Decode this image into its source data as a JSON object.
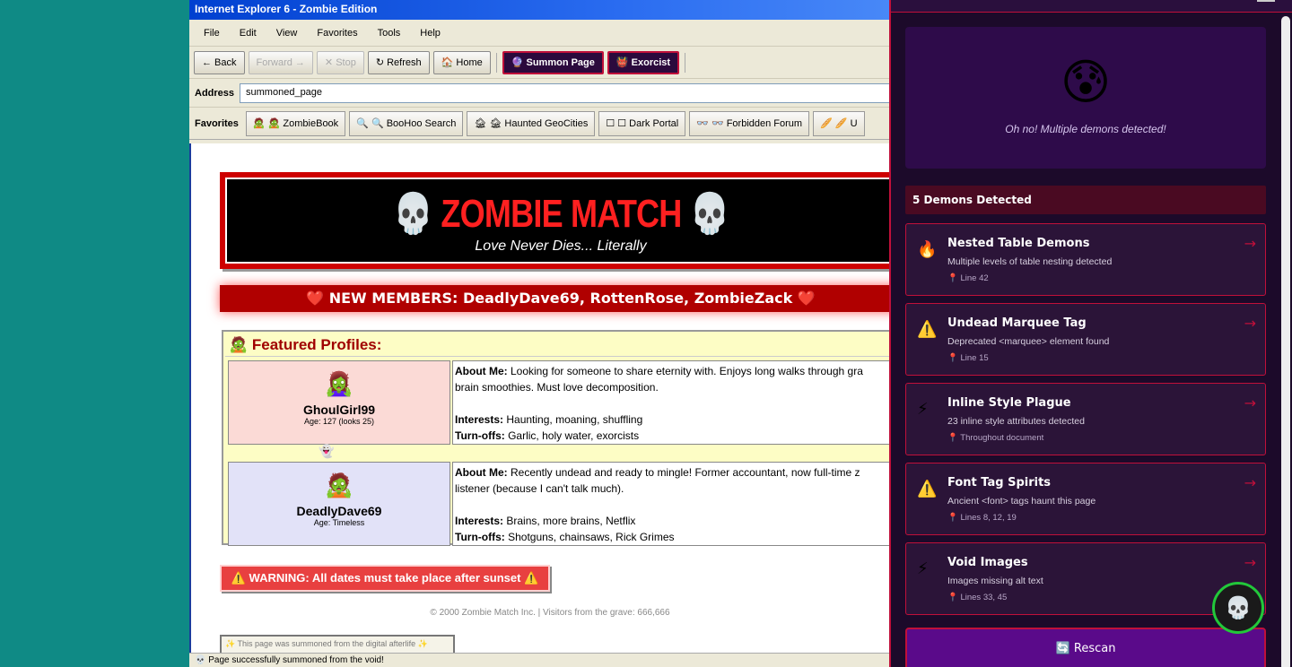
{
  "window": {
    "title": "Internet Explorer 6 - Zombie Edition"
  },
  "menu": [
    "File",
    "Edit",
    "View",
    "Favorites",
    "Tools",
    "Help"
  ],
  "toolbar": {
    "back": "← Back",
    "forward": "Forward →",
    "stop": "✕ Stop",
    "refresh": "↻ Refresh",
    "home": "🏠 Home",
    "summon": "🔮 Summon Page",
    "exorcist": "👹 Exorcist"
  },
  "address": {
    "label": "Address",
    "value": "summoned_page"
  },
  "favorites": {
    "label": "Favorites",
    "items": [
      "🧟 🧟 ZombieBook",
      "🔍 🔍 BooHoo Search",
      "🏚 🏚 Haunted GeoCities",
      "☐ ☐ Dark Portal",
      "👓 👓 Forbidden Forum",
      "🥖 🥖 U"
    ]
  },
  "page": {
    "banner_title": "💀 ZOMBIE MATCH 💀",
    "banner_subtitle": "Love Never Dies... Literally",
    "new_members": "❤️ NEW MEMBERS: DeadlyDave69, RottenRose, ZombieZack ❤️",
    "featured_header": "🧟 Featured Profiles:",
    "profiles": [
      {
        "avatar": "🧟‍♀️",
        "name": "GhoulGirl99",
        "age": "Age: 127 (looks 25)",
        "about_label": "About Me:",
        "about": " Looking for someone to share eternity with. Enjoys long walks through gra",
        "about2": "brain smoothies. Must love decomposition.",
        "interests_label": "Interests:",
        "interests": " Haunting, moaning, shuffling",
        "turnoffs_label": "Turn-offs:",
        "turnoffs": " Garlic, holy water, exorcists"
      },
      {
        "avatar": "🧟",
        "name": "DeadlyDave69",
        "age": "Age: Timeless",
        "about_label": "About Me:",
        "about": " Recently undead and ready to mingle! Former accountant, now full-time z",
        "about2": "listener (because I can't talk much).",
        "interests_label": "Interests:",
        "interests": " Brains, more brains, Netflix",
        "turnoffs_label": "Turn-offs:",
        "turnoffs": " Shotguns, chainsaws, Rick Grimes"
      }
    ],
    "ghost": "👻",
    "warning": "⚠️ WARNING: All dates must take place after sunset ⚠️",
    "copyright": "© 2000 Zombie Match Inc. | Visitors from the grave: 666,666",
    "summoned": "✨ This page was summoned from the digital afterlife ✨",
    "status": "💀 Page successfully summoned from the void!"
  },
  "panel": {
    "face": "😰",
    "message": "Oh no! Multiple demons detected!",
    "count": "5 Demons Detected",
    "demons": [
      {
        "icon": "🔥",
        "title": "Nested Table Demons",
        "desc": "Multiple levels of table nesting detected",
        "loc": "📍 Line 42"
      },
      {
        "icon": "⚠️",
        "title": "Undead Marquee Tag",
        "desc": "Deprecated <marquee> element found",
        "loc": "📍 Line 15"
      },
      {
        "icon": "⚡",
        "title": "Inline Style Plague",
        "desc": "23 inline style attributes detected",
        "loc": "📍 Throughout document"
      },
      {
        "icon": "⚠️",
        "title": "Font Tag Spirits",
        "desc": "Ancient <font> tags haunt this page",
        "loc": "📍 Lines 8, 12, 19"
      },
      {
        "icon": "⚡",
        "title": "Void Images",
        "desc": "Images missing alt text",
        "loc": "📍 Lines 33, 45"
      }
    ],
    "arrow": "→",
    "rescan": "🔄 Rescan",
    "skull": "💀"
  }
}
